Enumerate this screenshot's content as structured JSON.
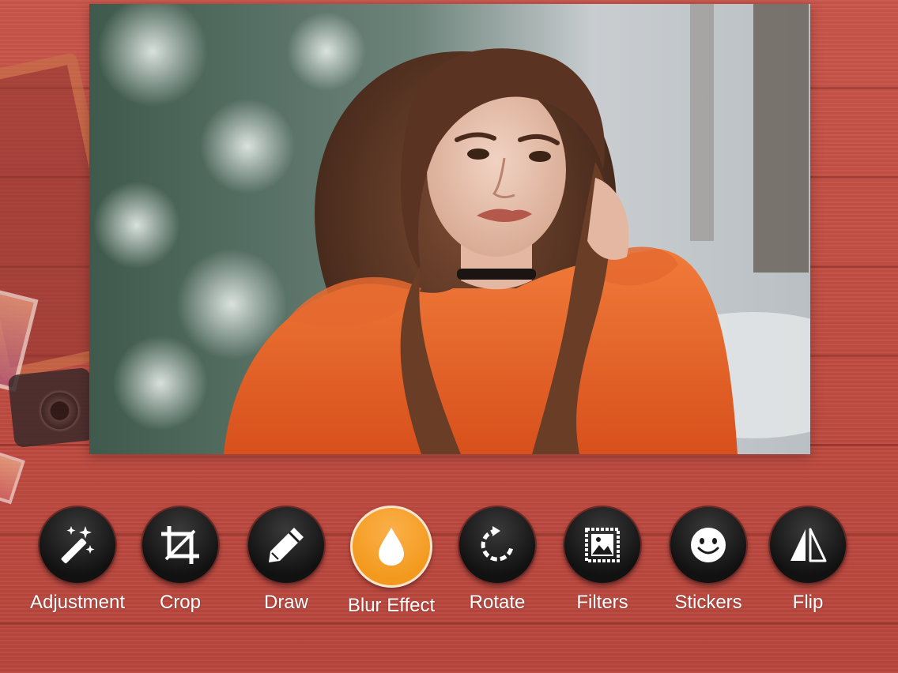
{
  "colors": {
    "background_wood": "#c4524a",
    "tool_dark": "#111111",
    "tool_active": "#f39a1e",
    "label_text": "#ffffff"
  },
  "canvas": {
    "subject": "photo-portrait"
  },
  "toolbar": {
    "selected": "blur_effect",
    "tools": [
      {
        "id": "adjustment",
        "label": "Adjustment",
        "icon": "magic-wand-icon"
      },
      {
        "id": "crop",
        "label": "Crop",
        "icon": "crop-icon"
      },
      {
        "id": "draw",
        "label": "Draw",
        "icon": "pencil-icon"
      },
      {
        "id": "blur_effect",
        "label": "Blur Effect",
        "icon": "droplet-icon"
      },
      {
        "id": "rotate",
        "label": "Rotate",
        "icon": "rotate-icon"
      },
      {
        "id": "filters",
        "label": "Filters",
        "icon": "filters-icon"
      },
      {
        "id": "stickers",
        "label": "Stickers",
        "icon": "smiley-icon"
      },
      {
        "id": "flip",
        "label": "Flip",
        "icon": "flip-icon"
      }
    ]
  }
}
